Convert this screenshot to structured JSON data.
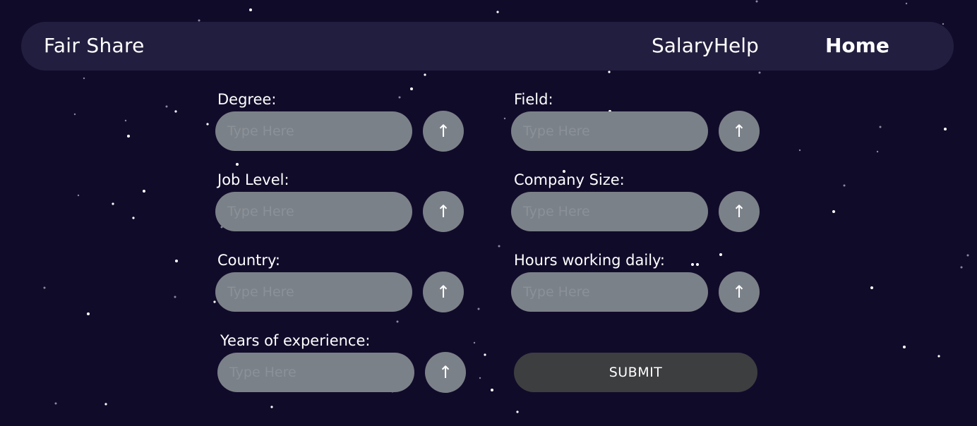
{
  "brand": "Fair Share",
  "nav": {
    "salary_help": "SalaryHelp",
    "home": "Home"
  },
  "form": {
    "placeholder": "Type Here",
    "upload_glyph": "↑",
    "fields": {
      "degree": "Degree:",
      "field": "Field:",
      "job_level": "Job Level:",
      "company_size": "Company Size:",
      "country": "Country:",
      "hours": "Hours working daily:",
      "experience": "Years of experience:"
    },
    "submit": "SUBMIT"
  },
  "colors": {
    "background": "#110b2a",
    "navbar": "#221e3f",
    "input": "#7b8188",
    "submit": "#3d3e40"
  }
}
